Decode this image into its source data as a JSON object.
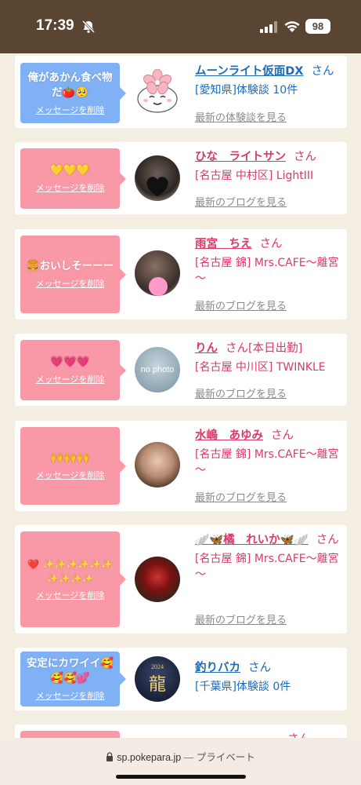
{
  "status_bar": {
    "time": "17:39",
    "battery": "98"
  },
  "url_bar": {
    "domain": "sp.pokepara.jp",
    "separator": " — ",
    "mode": "プライベート"
  },
  "cards": [
    {
      "message": "俺があかん食べ物だ🍅🥺",
      "delete_label": "メッセージを削除",
      "name": "ムーンライト仮面DX",
      "san": "さん",
      "status": "",
      "detail": "[愛知県]体験談 10件",
      "link": "最新の体験談を見る",
      "bubble": "blue",
      "avatar": "cherry-blossom"
    },
    {
      "message": "💛💛💛",
      "delete_label": "メッセージを削除",
      "name": "ひな　ライトサン",
      "san": "さん",
      "status": "",
      "detail": "[名古屋 中村区] LightIII",
      "link": "最新のブログを見る",
      "bubble": "pink",
      "avatar": "photo"
    },
    {
      "message": "🍔おいしそーーー",
      "delete_label": "メッセージを削除",
      "name": "雨宮　ちえ",
      "san": "さん",
      "status": "",
      "detail": "[名古屋 錦] Mrs.CAFE～離宮～",
      "link": "最新のブログを見る",
      "bubble": "pink",
      "avatar": "photo"
    },
    {
      "message": "💗💗💗",
      "delete_label": "メッセージを削除",
      "name": "りん",
      "san": "さん",
      "status": "[本日出勤]",
      "detail": "[名古屋 中川区] TWINKLE",
      "link": "最新のブログを見る",
      "bubble": "pink",
      "avatar": "no-photo",
      "avatar_text": "no photo"
    },
    {
      "message": "🙌🙌🙌",
      "delete_label": "メッセージを削除",
      "name": "水嶋　あゆみ",
      "san": "さん",
      "status": "",
      "detail": "[名古屋 錦] Mrs.CAFE～離宮～",
      "link": "最新のブログを見る",
      "bubble": "pink",
      "avatar": "photo"
    },
    {
      "message": "❤️ ✨✨✨✨✨✨✨✨✨✨",
      "delete_label": "メッセージを削除",
      "name": "🪽🦋橘　れいか🦋🪽",
      "san": "さん",
      "status": "",
      "detail": "[名古屋 錦] Mrs.CAFE～離宮～",
      "link": "最新のブログを見る",
      "bubble": "pink",
      "avatar": "photo"
    },
    {
      "message": "安定にカワイイ🥰🥰🥰💕",
      "delete_label": "メッセージを削除",
      "name": "釣りバカ",
      "san": "さん",
      "status": "",
      "detail": "[千葉県]体験談 0件",
      "link": "",
      "bubble": "blue",
      "avatar": "dragon",
      "avatar_year": "2024",
      "avatar_kanji": "龍"
    },
    {
      "message": "",
      "delete_label": "",
      "name": "",
      "san": "さん",
      "status": "",
      "detail": "",
      "link": "",
      "bubble": "pink",
      "avatar": "photo"
    }
  ]
}
